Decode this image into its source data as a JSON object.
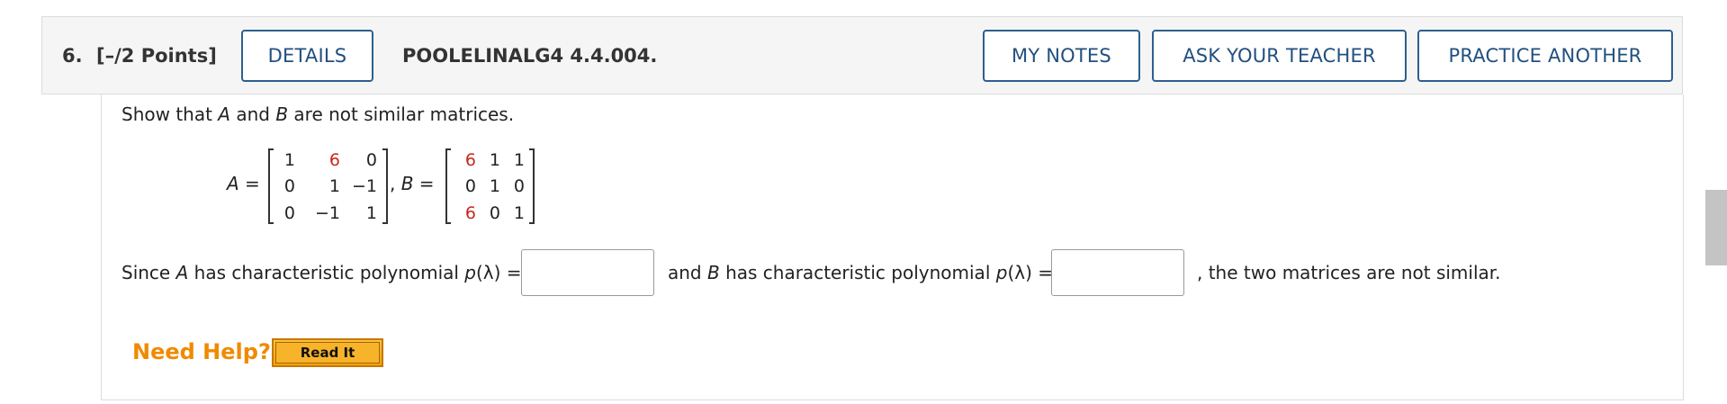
{
  "question": {
    "number": "6.",
    "points": "[–/2 Points]",
    "details_label": "DETAILS",
    "code": "POOLELINALG4 4.4.004.",
    "my_notes_label": "MY NOTES",
    "ask_teacher_label": "ASK YOUR TEACHER",
    "practice_label": "PRACTICE ANOTHER"
  },
  "prompt": {
    "pre": "Show that ",
    "a": "A",
    "mid": " and ",
    "b": "B",
    "post": " are not similar matrices."
  },
  "matrices": {
    "a_label": "A =",
    "comma_b_label": ", B =",
    "A": [
      [
        "1",
        "6",
        "0"
      ],
      [
        "0",
        "1",
        "−1"
      ],
      [
        "0",
        "−1",
        "1"
      ]
    ],
    "B": [
      [
        "6",
        "1",
        "1"
      ],
      [
        "0",
        "1",
        "0"
      ],
      [
        "6",
        "0",
        "1"
      ]
    ]
  },
  "answer_line": {
    "since": "Since ",
    "a": "A",
    "has_poly": " has characteristic polynomial ",
    "p": "p",
    "lambda": "(λ) =",
    "and": "and ",
    "b": "B",
    "has_poly_b": " has characteristic polynomial ",
    "ending": ", the two matrices are not similar.",
    "answer1_value": "",
    "answer2_value": ""
  },
  "help": {
    "need_help": "Need Help?",
    "read_it": "Read It"
  },
  "colors": {
    "accent_blue": "#22507f",
    "highlight_red": "#c8261e",
    "help_orange": "#f08a00"
  }
}
